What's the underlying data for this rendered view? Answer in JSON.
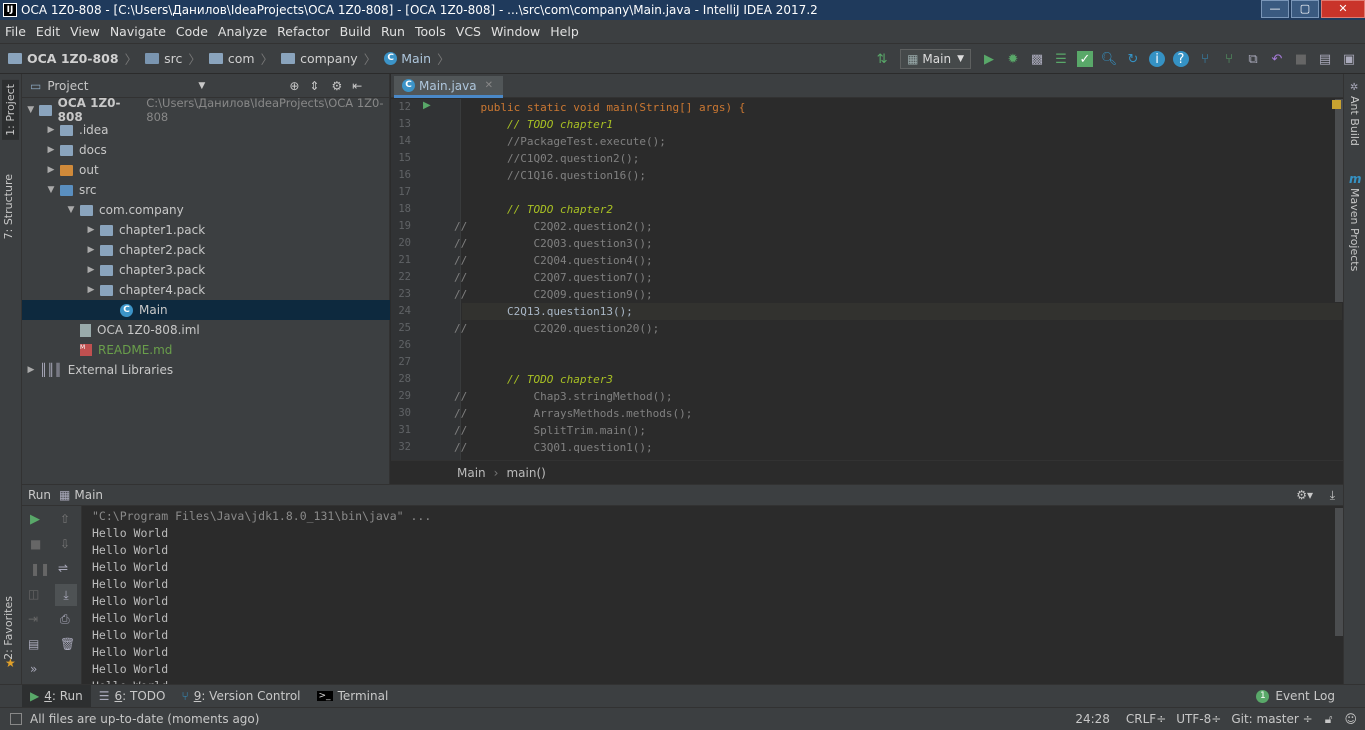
{
  "window": {
    "app_icon": "IJ",
    "title": "OCA 1Z0-808 - [C:\\Users\\Данилов\\IdeaProjects\\OCA 1Z0-808] - [OCA 1Z0-808] - ...\\src\\com\\company\\Main.java - IntelliJ IDEA 2017.2",
    "minimize": "—",
    "maximize": "▢",
    "close": "✕"
  },
  "menu": [
    "File",
    "Edit",
    "View",
    "Navigate",
    "Code",
    "Analyze",
    "Refactor",
    "Build",
    "Run",
    "Tools",
    "VCS",
    "Window",
    "Help"
  ],
  "breadcrumb": [
    "OCA 1Z0-808",
    "src",
    "com",
    "company",
    "Main"
  ],
  "run_config": "Main",
  "left_strip": {
    "project": "1: Project",
    "structure": "7: Structure",
    "favorites": "2: Favorites"
  },
  "right_strip": {
    "ant": "Ant Build",
    "maven": "Maven Projects"
  },
  "project_panel": {
    "title": "Project",
    "tree": [
      {
        "label": "OCA 1Z0-808",
        "path": "C:\\Users\\Данилов\\IdeaProjects\\OCA 1Z0-808",
        "arrow": "▼",
        "indent": 0,
        "icon": "folder"
      },
      {
        "label": ".idea",
        "arrow": "▶",
        "indent": 1,
        "icon": "folder"
      },
      {
        "label": "docs",
        "arrow": "▶",
        "indent": 1,
        "icon": "folder"
      },
      {
        "label": "out",
        "arrow": "▶",
        "indent": 1,
        "icon": "folder-orange"
      },
      {
        "label": "src",
        "arrow": "▼",
        "indent": 1,
        "icon": "folder-blue"
      },
      {
        "label": "com.company",
        "arrow": "▼",
        "indent": 2,
        "icon": "package"
      },
      {
        "label": "chapter1.pack",
        "arrow": "▶",
        "indent": 3,
        "icon": "package"
      },
      {
        "label": "chapter2.pack",
        "arrow": "▶",
        "indent": 3,
        "icon": "package"
      },
      {
        "label": "chapter3.pack",
        "arrow": "▶",
        "indent": 3,
        "icon": "package"
      },
      {
        "label": "chapter4.pack",
        "arrow": "▶",
        "indent": 3,
        "icon": "package"
      },
      {
        "label": "Main",
        "arrow": "",
        "indent": 4,
        "icon": "class",
        "selected": true
      },
      {
        "label": "OCA 1Z0-808.iml",
        "arrow": "",
        "indent": 2,
        "icon": "iml"
      },
      {
        "label": "README.md",
        "arrow": "",
        "indent": 2,
        "icon": "md"
      },
      {
        "label": "External Libraries",
        "arrow": "▶",
        "indent": 0,
        "icon": "library"
      }
    ]
  },
  "editor": {
    "tab": "Main.java",
    "lines": [
      {
        "n": "12",
        "code": "    public static void main(String[] args) {"
      },
      {
        "n": "13",
        "code": "        // TODO chapter1"
      },
      {
        "n": "14",
        "code": "        //PackageTest.execute();"
      },
      {
        "n": "15",
        "code": "        //C1Q02.question2();"
      },
      {
        "n": "16",
        "code": "        //C1Q16.question16();"
      },
      {
        "n": "17",
        "code": ""
      },
      {
        "n": "18",
        "code": "        // TODO chapter2"
      },
      {
        "n": "19",
        "code": "//          C2Q02.question2();"
      },
      {
        "n": "20",
        "code": "//          C2Q03.question3();"
      },
      {
        "n": "21",
        "code": "//          C2Q04.question4();"
      },
      {
        "n": "22",
        "code": "//          C2Q07.question7();"
      },
      {
        "n": "23",
        "code": "//          C2Q09.question9();"
      },
      {
        "n": "24",
        "code": "        C2Q13.question13();"
      },
      {
        "n": "25",
        "code": "//          C2Q20.question20();"
      },
      {
        "n": "26",
        "code": ""
      },
      {
        "n": "27",
        "code": ""
      },
      {
        "n": "28",
        "code": "        // TODO chapter3"
      },
      {
        "n": "29",
        "code": "//          Chap3.stringMethod();"
      },
      {
        "n": "30",
        "code": "//          ArraysMethods.methods();"
      },
      {
        "n": "31",
        "code": "//          SplitTrim.main();"
      },
      {
        "n": "32",
        "code": "//          C3Q01.question1();"
      }
    ],
    "breadcrumb": [
      "Main",
      "main()"
    ]
  },
  "run_panel": {
    "title_run": "Run",
    "title_config": "Main",
    "command": "\"C:\\Program Files\\Java\\jdk1.8.0_131\\bin\\java\" ...",
    "output": [
      "Hello World",
      "Hello World",
      "Hello World",
      "Hello World",
      "Hello World",
      "Hello World",
      "Hello World",
      "Hello World",
      "Hello World",
      "Hello World"
    ]
  },
  "bottom_tabs": [
    {
      "key": "4",
      "rest": ": Run",
      "icon": "▶",
      "active": true
    },
    {
      "key": "6",
      "rest": ": TODO",
      "icon": "☰"
    },
    {
      "key": "9",
      "rest": ": Version Control",
      "icon": "⑂"
    },
    {
      "key": "",
      "rest": "Terminal",
      "icon": "▭"
    }
  ],
  "event_log": "Event Log",
  "event_badge": "1",
  "status": {
    "message": "All files are up-to-date (moments ago)",
    "position": "24:28",
    "line_sep": "CRLF÷",
    "encoding": "UTF-8÷",
    "vcs": "Git: master ÷"
  },
  "colors": {
    "accent": "#4a88c7",
    "run_green": "#59a869",
    "selection": "#0d293e"
  }
}
